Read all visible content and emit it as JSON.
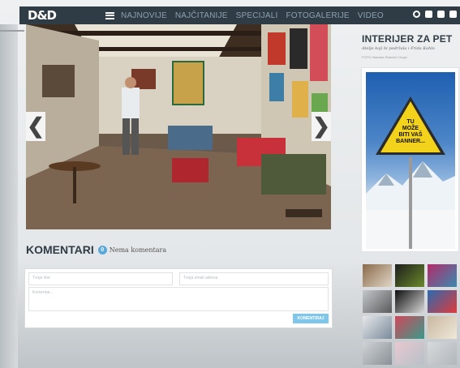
{
  "brand": {
    "logo": "D&D"
  },
  "nav": {
    "items": [
      "NAJNOVIJE",
      "NAJČITANIJE",
      "SPECIJALI",
      "FOTOGALERIJE",
      "VIDEO"
    ]
  },
  "slider": {
    "prev": "❮",
    "next": "❯"
  },
  "comments": {
    "title": "KOMENTARI",
    "count": "0",
    "status": "Nema komentara",
    "name_placeholder": "Tvoje ime",
    "email_placeholder": "Tvoja email adresa",
    "comment_placeholder": "Komentar...",
    "submit_label": "KOMENTIRAJ"
  },
  "article": {
    "title": "INTERIJER ZA PET",
    "subtitle": "Atelje koji bi podržala i Frida Kahlo",
    "credit": "FOTO: Barbara Radović Cergic"
  },
  "banner": {
    "line1": "TU",
    "line2": "MOŽE",
    "line3": "BITI VAŠ",
    "line4": "BANNER..."
  }
}
